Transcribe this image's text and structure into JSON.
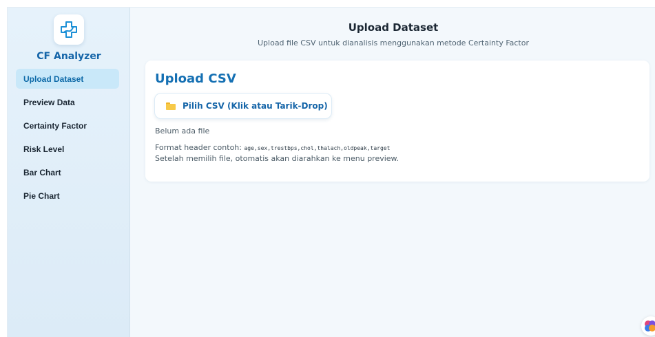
{
  "app": {
    "name": "CF Analyzer",
    "logo_icon": "medical-cross-icon",
    "accent_color": "#1565a8"
  },
  "sidebar": {
    "items": [
      {
        "label": "Upload Dataset",
        "active": true
      },
      {
        "label": "Preview Data",
        "active": false
      },
      {
        "label": "Certainty Factor",
        "active": false
      },
      {
        "label": "Risk Level",
        "active": false
      },
      {
        "label": "Bar Chart",
        "active": false
      },
      {
        "label": "Pie Chart",
        "active": false
      }
    ]
  },
  "header": {
    "title": "Upload Dataset",
    "subtitle": "Upload file CSV untuk dianalisis menggunakan metode Certainty Factor"
  },
  "upload_card": {
    "title": "Upload CSV",
    "button_icon": "folder-icon",
    "button_label": "Pilih CSV (Klik atau Tarik-Drop)",
    "file_status": "Belum ada file",
    "format_prefix": "Format header contoh: ",
    "format_example": "age,sex,trestbps,chol,thalach,oldpeak,target",
    "hint": "Setelah memilih file, otomatis akan diarahkan ke menu preview."
  },
  "corner_widget": {
    "icon": "assistant-icon"
  }
}
